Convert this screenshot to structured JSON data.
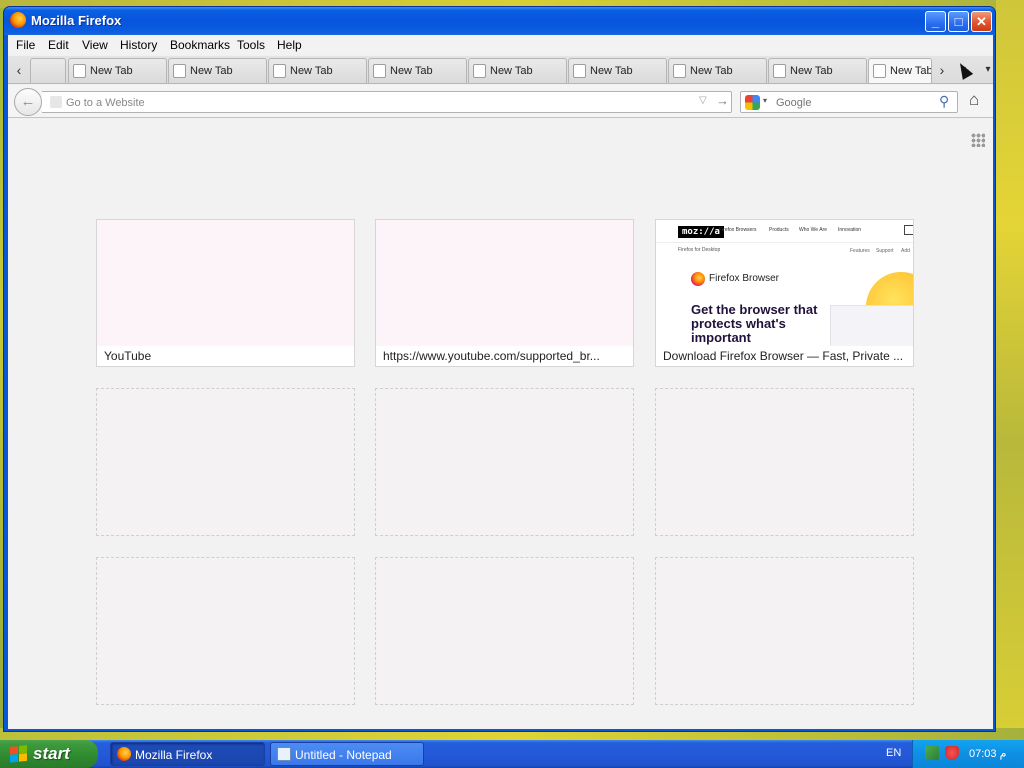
{
  "window": {
    "title": "Mozilla Firefox",
    "controls": {
      "minimize": "_",
      "maximize": "□",
      "close": "✕"
    }
  },
  "menubar": [
    "File",
    "Edit",
    "View",
    "History",
    "Bookmarks",
    "Tools",
    "Help"
  ],
  "tabs": {
    "scroll_left": "‹",
    "scroll_right": "›",
    "new_tab": "+",
    "list_all": "▾",
    "items": [
      {
        "label": "New Tab"
      },
      {
        "label": "New Tab"
      },
      {
        "label": "New Tab"
      },
      {
        "label": "New Tab"
      },
      {
        "label": "New Tab"
      },
      {
        "label": "New Tab"
      },
      {
        "label": "New Tab"
      },
      {
        "label": "New Tab"
      },
      {
        "label": "New Tab",
        "active": true
      }
    ]
  },
  "navbar": {
    "back": "←",
    "url_placeholder": "Go to a Website",
    "url_dropdown": "▽",
    "url_go": "→",
    "search_placeholder": "Google",
    "search_engine_dropdown": "▾",
    "search_go": "⚲",
    "home": "⌂"
  },
  "tiles": [
    {
      "title": "YouTube",
      "thumbnail": "blank"
    },
    {
      "title": "https://www.youtube.com/supported_br...",
      "thumbnail": "blank"
    },
    {
      "title": "Download Firefox Browser — Fast, Private ...",
      "thumbnail": "mozilla",
      "thumb_text": {
        "logo": "moz://a",
        "nav": [
          "Firefox Browsers",
          "Products",
          "Who We Are",
          "Innovation"
        ],
        "sub": "Firefox for Desktop",
        "sub_right": [
          "Features",
          "Support",
          "Add"
        ],
        "brand": "Firefox Browser",
        "headline": "Get the browser that protects what's important"
      }
    }
  ],
  "empty_tiles": 6,
  "taskbar": {
    "start_label": "start",
    "tasks": [
      {
        "label": "Mozilla Firefox",
        "active": true,
        "icon": "firefox-icon"
      },
      {
        "label": "Untitled - Notepad",
        "active": false,
        "icon": "notepad-icon"
      }
    ],
    "language": "EN",
    "clock": "07:03 م"
  }
}
